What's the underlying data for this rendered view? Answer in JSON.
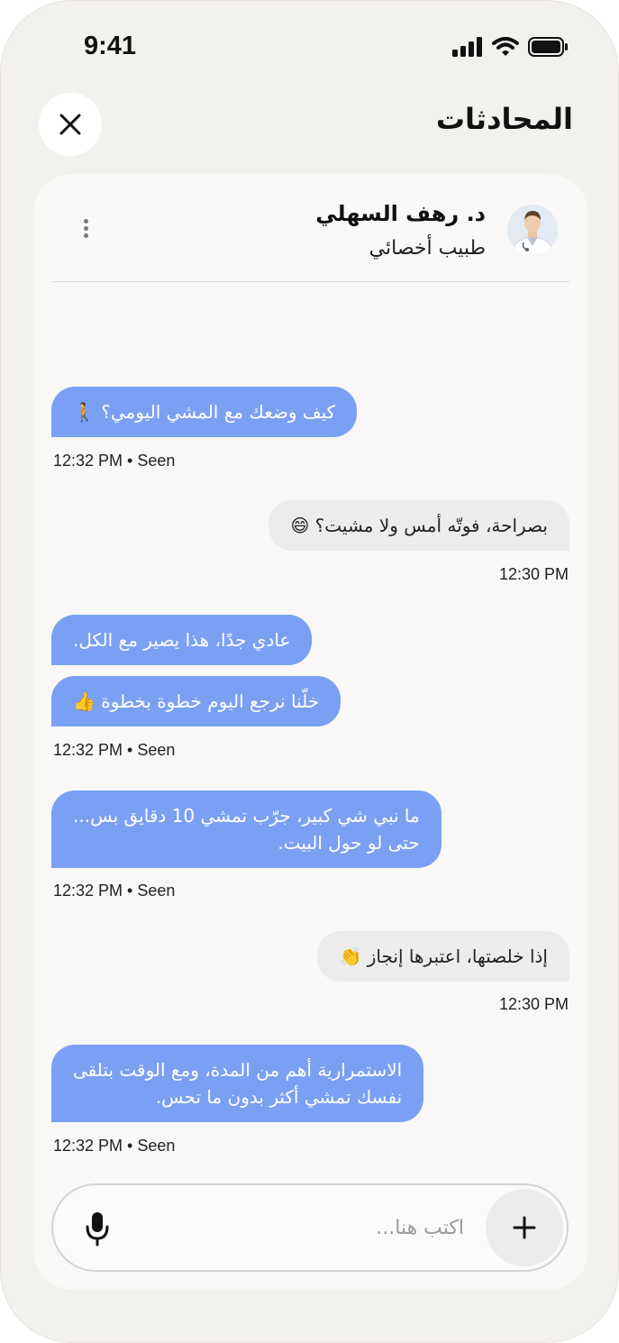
{
  "status": {
    "time": "9:41"
  },
  "page": {
    "title": "المحادثات"
  },
  "doctor": {
    "name": "د. رهف السهلي",
    "role": "طبيب أخصائي"
  },
  "messages": [
    {
      "from": "doctor",
      "lines": [
        "كيف وضعك مع المشي اليومي؟ 🚶"
      ],
      "meta": "12:32 PM • Seen"
    },
    {
      "from": "me",
      "lines": [
        "بصراحة، فوتّه أمس ولا مشيت؟ 😄"
      ],
      "meta": "12:30 PM"
    },
    {
      "from": "doctor",
      "lines": [
        "عادي جدًا، هذا يصير مع الكل."
      ]
    },
    {
      "from": "doctor",
      "lines": [
        "خلّنا نرجع اليوم خطوة بخطوة 👍"
      ],
      "meta": "12:32 PM • Seen"
    },
    {
      "from": "doctor",
      "lines": [
        "ما نبي شي كبير، جرّب تمشي 10 دقايق بس...",
        "حتى لو حول البيت."
      ],
      "meta": "12:32 PM • Seen"
    },
    {
      "from": "me",
      "lines": [
        "إذا خلصتها، اعتبرها إنجاز 👏"
      ],
      "meta": "12:30 PM"
    },
    {
      "from": "doctor",
      "lines": [
        "الاستمرارية أهم من المدة، ومع الوقت بتلقى",
        "نفسك تمشي أكثر بدون ما تحس."
      ],
      "meta": "12:32 PM • Seen"
    }
  ],
  "composer": {
    "placeholder": "اكتب هنا..."
  },
  "icons": {
    "signal": "signal-icon",
    "wifi": "wifi-icon",
    "battery": "battery-icon",
    "close": "close-icon",
    "more": "more-vertical-icon",
    "mic": "microphone-icon",
    "plus": "plus-icon"
  },
  "colors": {
    "doctor_bubble": "#7aa0f3",
    "my_bubble": "#ececec",
    "background": "#f3f1ed"
  }
}
